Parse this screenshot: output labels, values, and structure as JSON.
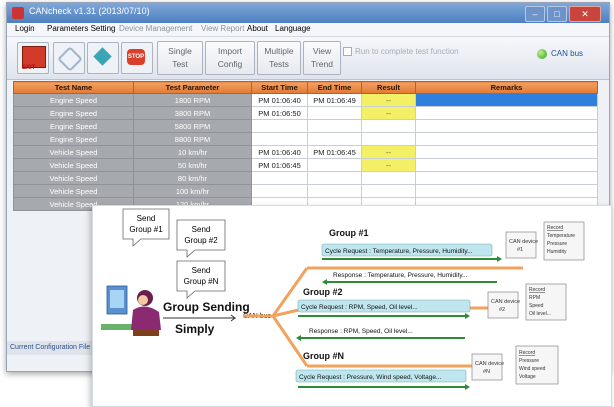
{
  "window": {
    "title": "CANcheck v1.31 (2013/07/10)"
  },
  "menu": [
    "Login",
    "Parameters Setting",
    "Device Management",
    "View Report",
    "About",
    "Language"
  ],
  "toolbar": {
    "exit_label": "EXIT",
    "stop_label": "STOP",
    "single_test": [
      "Single",
      "Test"
    ],
    "import_config": [
      "Import",
      "Config"
    ],
    "multiple_tests": [
      "Multiple",
      "Tests"
    ],
    "view_trend": [
      "View",
      "Trend"
    ],
    "checkbox_label": "Run to complete test function",
    "can_label": "CAN bus"
  },
  "table": {
    "headers": [
      "Test Name",
      "Test Parameter",
      "Start Time",
      "End Time",
      "Result",
      "Remarks"
    ],
    "rows": [
      {
        "name": "Engine Speed",
        "param": "1800 RPM",
        "start": "PM 01:06:40",
        "end": "PM 01:06:49",
        "result": "--",
        "warn": true,
        "sel": true
      },
      {
        "name": "Engine Speed",
        "param": "3800 RPM",
        "start": "PM 01:06:50",
        "end": "",
        "result": "--",
        "warn": true,
        "sel": false
      },
      {
        "name": "Engine Speed",
        "param": "5800 RPM",
        "start": "",
        "end": "",
        "result": "",
        "warn": false,
        "sel": false
      },
      {
        "name": "Engine Speed",
        "param": "8800 RPM",
        "start": "",
        "end": "",
        "result": "",
        "warn": false,
        "sel": false
      },
      {
        "name": "Vehicle Speed",
        "param": "10 km/hr",
        "start": "PM 01:06:40",
        "end": "PM 01:06:45",
        "result": "--",
        "warn": true,
        "sel": false
      },
      {
        "name": "Vehicle Speed",
        "param": "50 km/hr",
        "start": "PM 01:06:45",
        "end": "",
        "result": "--",
        "warn": true,
        "sel": false
      },
      {
        "name": "Vehicle Speed",
        "param": "80 km/hr",
        "start": "",
        "end": "",
        "result": "",
        "warn": false,
        "sel": false
      },
      {
        "name": "Vehicle Speed",
        "param": "100 km/hr",
        "start": "",
        "end": "",
        "result": "",
        "warn": false,
        "sel": false
      },
      {
        "name": "Vehicle Speed",
        "param": "120 km/hr",
        "start": "",
        "end": "",
        "result": "",
        "warn": false,
        "sel": false
      }
    ]
  },
  "status": {
    "text": "Current Configuration File"
  },
  "diagram": {
    "bubbles": [
      [
        "Send",
        "Group #1"
      ],
      [
        "Send",
        "Group #2"
      ],
      [
        "Send",
        "Group #N"
      ]
    ],
    "center_title": "Group Sending",
    "center_sub": "Simply",
    "bus_label": "CAN bus",
    "groups": [
      {
        "title": "Group #1",
        "request": "Cycle Request : Temperature, Pressure, Humidity...",
        "response": "Response : Temperature, Pressure, Humidity...",
        "device": [
          "CAN device",
          "#1"
        ],
        "record": [
          "Record",
          "Temperature",
          "Pressure",
          "Humidity"
        ]
      },
      {
        "title": "Group #2",
        "request": "Cycle Request : RPM, Speed, Oil level...",
        "response": "Response : RPM, Speed, Oil level...",
        "device": [
          "CAN device",
          "#2"
        ],
        "record": [
          "Record",
          "RPM",
          "Speed",
          "Oil level..."
        ]
      },
      {
        "title": "Group #N",
        "request": "Cycle Request : Pressure, Wind speed, Voltage...",
        "response": "",
        "device": [
          "CAN device",
          "#N"
        ],
        "record": [
          "Record",
          "Pressure",
          "Wind speed",
          "Voltage"
        ]
      }
    ]
  },
  "colors": {
    "header_orange": "#e8873f",
    "bus_orange": "#f2a25c",
    "arrow_green": "#2e8b3a",
    "request_blue": "#bfe6ee"
  }
}
